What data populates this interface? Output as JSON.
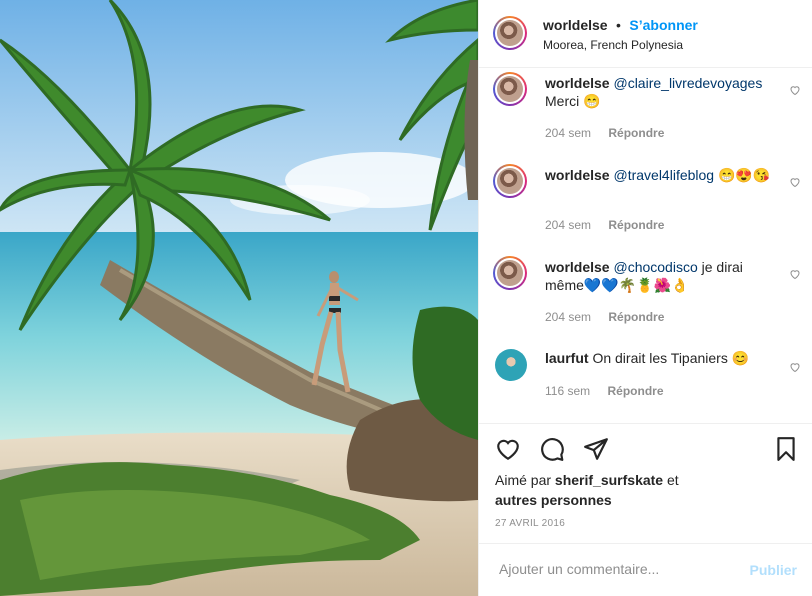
{
  "post": {
    "username": "worldelse",
    "separator": "•",
    "follow_label": "S’abonner",
    "location": "Moorea, French Polynesia"
  },
  "comments": [
    {
      "user": "worldelse",
      "mention": "@claire_livredevoyages",
      "text": "Merci 😁",
      "time": "204 sem",
      "reply": "Répondre"
    },
    {
      "user": "worldelse",
      "mention": "@travel4lifeblog",
      "text": "😁😍😘",
      "time": "204 sem",
      "reply": "Répondre"
    },
    {
      "user": "worldelse",
      "mention": "@chocodisco",
      "text": "je dirai même💙💙🌴🍍🌺👌",
      "time": "204 sem",
      "reply": "Répondre"
    },
    {
      "user": "laurfut",
      "mention": "",
      "text": "On dirait les Tipaniers 😊",
      "time": "116 sem",
      "reply": "Répondre"
    }
  ],
  "likes": {
    "prefix": "Aimé par",
    "user": "sherif_surfskate",
    "middle": "et",
    "others": "autres personnes"
  },
  "date": "27 AVRIL 2016",
  "add_comment": {
    "placeholder": "Ajouter un commentaire...",
    "publish_label": "Publier"
  },
  "icons": [
    "heart-icon",
    "comment-icon",
    "share-icon",
    "bookmark-icon",
    "small-heart-icon"
  ]
}
